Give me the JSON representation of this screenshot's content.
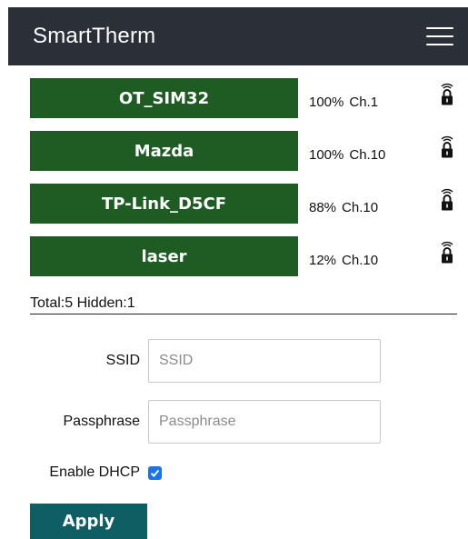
{
  "header": {
    "title": "SmartTherm",
    "menu_icon": "hamburger-menu-icon"
  },
  "networks": [
    {
      "ssid": "OT_SIM32",
      "signal": "100%",
      "channel": "Ch.1",
      "icon": "lock-icon"
    },
    {
      "ssid": "Mazda",
      "signal": "100%",
      "channel": "Ch.10",
      "icon": "lock-icon"
    },
    {
      "ssid": "TP-Link_D5CF",
      "signal": "88%",
      "channel": "Ch.10",
      "icon": "lock-icon"
    },
    {
      "ssid": "laser",
      "signal": "12%",
      "channel": "Ch.10",
      "icon": "lock-icon"
    }
  ],
  "totals": "Total:5 Hidden:1",
  "form": {
    "ssid_label": "SSID",
    "ssid_placeholder": "SSID",
    "ssid_value": "",
    "passphrase_label": "Passphrase",
    "passphrase_placeholder": "Passphrase",
    "passphrase_value": "",
    "dhcp_label": "Enable DHCP",
    "dhcp_checked": true
  },
  "apply_label": "Apply",
  "colors": {
    "header_bg": "#2b3038",
    "network_button_bg": "#1f5c23",
    "apply_button_bg": "#0f5e63",
    "checkbox_accent": "#1a73e8"
  }
}
